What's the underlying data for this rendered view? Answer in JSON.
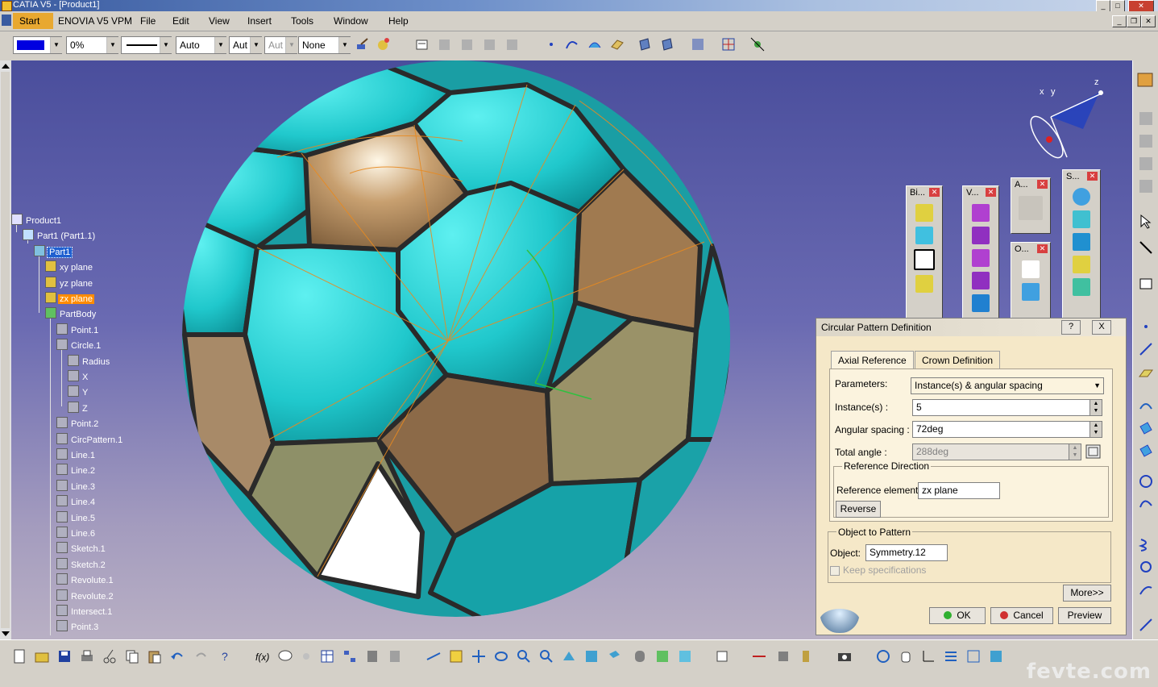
{
  "window": {
    "title": "CATIA V5 - [Product1]"
  },
  "menu": {
    "items": [
      "Start",
      "ENOVIA V5 VPM",
      "File",
      "Edit",
      "View",
      "Insert",
      "Tools",
      "Window",
      "Help"
    ]
  },
  "format_toolbar": {
    "color_value": "",
    "transparency": "0%",
    "linetype": "",
    "thickness": "Auto",
    "field2": "Aut",
    "field3": "Aut",
    "layer": "None"
  },
  "tree": {
    "nodes": [
      {
        "label": "Product1",
        "state": "normal"
      },
      {
        "label": "Part1 (Part1.1)",
        "state": "normal"
      },
      {
        "label": "Part1",
        "state": "selected"
      },
      {
        "label": "xy plane",
        "state": "normal"
      },
      {
        "label": "yz plane",
        "state": "normal"
      },
      {
        "label": "zx plane",
        "state": "highlight"
      },
      {
        "label": "PartBody",
        "state": "normal"
      },
      {
        "label": "Point.1",
        "state": "normal"
      },
      {
        "label": "Circle.1",
        "state": "normal"
      },
      {
        "label": "Radius",
        "state": "normal"
      },
      {
        "label": "X",
        "state": "normal"
      },
      {
        "label": "Y",
        "state": "normal"
      },
      {
        "label": "Z",
        "state": "normal"
      },
      {
        "label": "Point.2",
        "state": "normal"
      },
      {
        "label": "CircPattern.1",
        "state": "normal"
      },
      {
        "label": "Line.1",
        "state": "normal"
      },
      {
        "label": "Line.2",
        "state": "normal"
      },
      {
        "label": "Line.3",
        "state": "normal"
      },
      {
        "label": "Line.4",
        "state": "normal"
      },
      {
        "label": "Line.5",
        "state": "normal"
      },
      {
        "label": "Line.6",
        "state": "normal"
      },
      {
        "label": "Sketch.1",
        "state": "normal"
      },
      {
        "label": "Sketch.2",
        "state": "normal"
      },
      {
        "label": "Revolute.1",
        "state": "normal"
      },
      {
        "label": "Revolute.2",
        "state": "normal"
      },
      {
        "label": "Intersect.1",
        "state": "normal"
      },
      {
        "label": "Point.3",
        "state": "normal"
      }
    ]
  },
  "floating_toolbars": [
    {
      "title": "Bi..."
    },
    {
      "title": "V..."
    },
    {
      "title": "A..."
    },
    {
      "title": "O..."
    },
    {
      "title": "S..."
    }
  ],
  "compass": {
    "x": "x",
    "y": "y",
    "z": "z"
  },
  "dialog": {
    "title": "Circular Pattern Definition",
    "help_btn": "?",
    "close_btn": "X",
    "tabs": [
      "Axial Reference",
      "Crown Definition"
    ],
    "parameters_label": "Parameters:",
    "parameters_value": "Instance(s) & angular spacing",
    "instances_label": "Instance(s) :",
    "instances_value": "5",
    "angular_spacing_label": "Angular spacing :",
    "angular_spacing_value": "72deg",
    "total_angle_label": "Total angle :",
    "total_angle_value": "288deg",
    "ref_direction_title": "Reference Direction",
    "ref_element_label": "Reference element:",
    "ref_element_value": "zx plane",
    "reverse_btn": "Reverse",
    "object_title": "Object to Pattern",
    "object_label": "Object:",
    "object_value": "Symmetry.12",
    "keep_specs": "Keep specifications",
    "more_btn": "More>>",
    "ok_btn": "OK",
    "cancel_btn": "Cancel",
    "preview_btn": "Preview"
  },
  "watermark": "fevte.com",
  "colors": {
    "cyan_face": "#2ad3d8",
    "tan_face": "#b08a60",
    "accent_orange": "#e88a20",
    "viewport_top": "#4a4e9c"
  }
}
